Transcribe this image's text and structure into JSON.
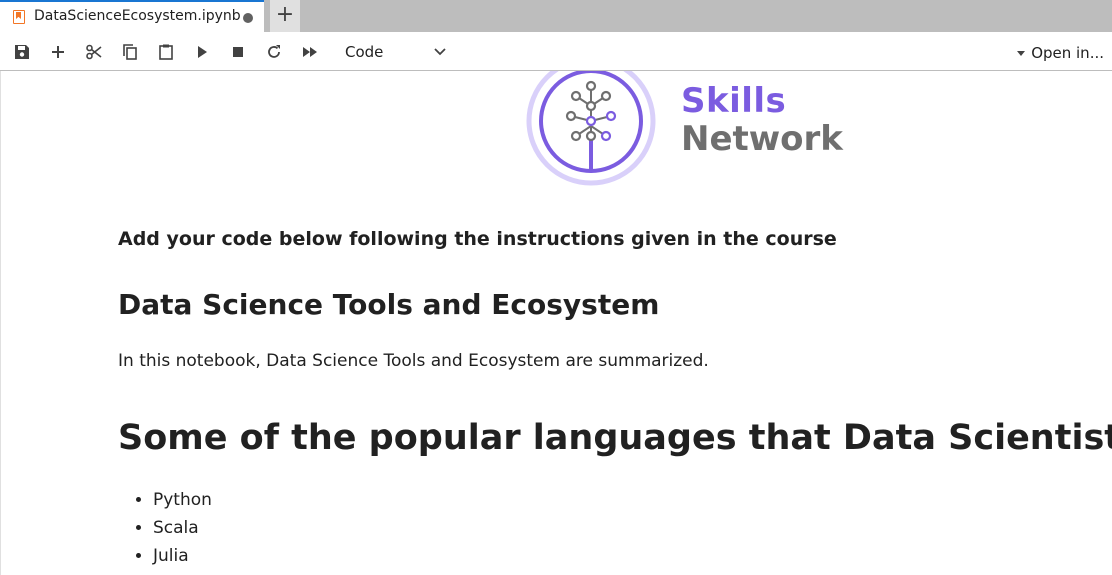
{
  "tab": {
    "title": "DataScienceEcosystem.ipynb",
    "new_tab_symbol": "+"
  },
  "toolbar": {
    "buttons": [
      {
        "name": "save-icon"
      },
      {
        "name": "add-cell-icon"
      },
      {
        "name": "cut-icon"
      },
      {
        "name": "copy-icon"
      },
      {
        "name": "paste-icon"
      },
      {
        "name": "run-icon"
      },
      {
        "name": "stop-icon"
      },
      {
        "name": "restart-icon"
      },
      {
        "name": "run-all-icon"
      }
    ],
    "cell_type": "Code",
    "open_in": "Open in..."
  },
  "notebook": {
    "logo": {
      "line1": "Skills",
      "line2": "Network",
      "primary_color": "#7b5ce0",
      "secondary_color": "#6f6f6f"
    },
    "instruction": "Add your code below following the instructions given in the course",
    "heading2": "Data Science Tools and Ecosystem",
    "paragraph": "In this notebook, Data Science Tools and Ecosystem are summarized.",
    "heading1": "Some of the popular languages that Data Scientists use are:",
    "languages": [
      "Python",
      "Scala",
      "Julia"
    ]
  }
}
